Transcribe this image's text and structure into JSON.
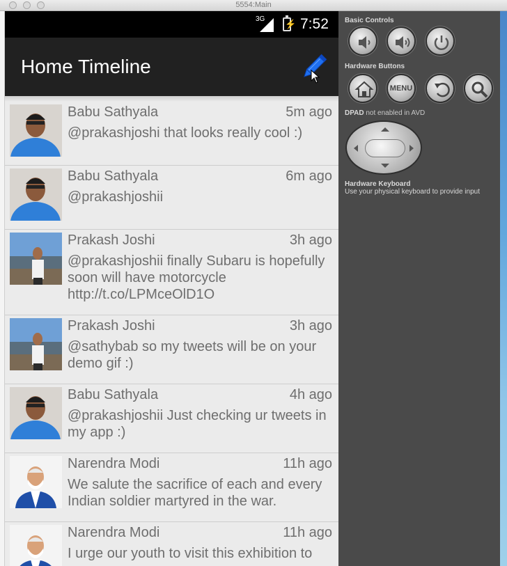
{
  "window": {
    "title": "5554:Main"
  },
  "status_bar": {
    "network": "3G",
    "time": "7:52"
  },
  "action_bar": {
    "title": "Home Timeline",
    "compose_icon": "pencil-icon"
  },
  "tweets": [
    {
      "name": "Babu Sathyala",
      "time": "5m ago",
      "text": "@prakashjoshi that looks really cool :)"
    },
    {
      "name": "Babu Sathyala",
      "time": "6m ago",
      "text": "@prakashjoshii"
    },
    {
      "name": "Prakash Joshi",
      "time": "3h ago",
      "text": "@prakashjoshii finally Subaru is hopefully soon will have motorcycle http://t.co/LPMceOlD1O"
    },
    {
      "name": "Prakash Joshi",
      "time": "3h ago",
      "text": "@sathybab so my tweets will be on your demo gif :)"
    },
    {
      "name": "Babu Sathyala",
      "time": "4h ago",
      "text": "@prakashjoshii Just checking ur tweets in my app :)"
    },
    {
      "name": "Narendra Modi",
      "time": "11h ago",
      "text": "We salute the sacrifice of each and every Indian soldier martyred in the war."
    },
    {
      "name": "Narendra Modi",
      "time": "11h ago",
      "text": "I urge our youth to visit this exhibition to"
    }
  ],
  "controls": {
    "basic_controls_label": "Basic Controls",
    "hardware_buttons_label": "Hardware Buttons",
    "menu_label": "MENU",
    "dpad_label": "DPAD",
    "dpad_note": "not enabled in AVD",
    "hardware_keyboard_label": "Hardware Keyboard",
    "hardware_keyboard_note": "Use your physical keyboard to provide input"
  }
}
